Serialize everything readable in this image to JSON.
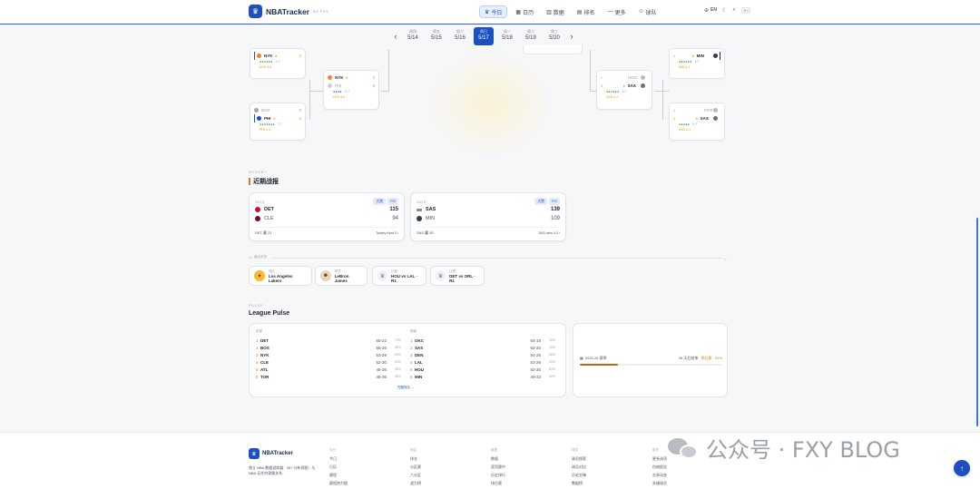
{
  "header": {
    "brand": "NBATracker",
    "brand_by": "BY FXY",
    "nav": [
      {
        "label": "今日",
        "icon": "trophy-icon",
        "active": true
      },
      {
        "label": "日历",
        "icon": "calendar-icon"
      },
      {
        "label": "数据",
        "icon": "bar-chart-icon"
      },
      {
        "label": "排名",
        "icon": "ranking-icon"
      },
      {
        "label": "更多",
        "icon": "more-icon"
      },
      {
        "label": "球队",
        "icon": "team-icon"
      }
    ],
    "lang": "EN",
    "search_hint": "⌘K"
  },
  "dates": [
    {
      "wd": "周四",
      "d": "5/14"
    },
    {
      "wd": "周五",
      "d": "5/15"
    },
    {
      "wd": "周六",
      "d": "5/16"
    },
    {
      "wd": "周日",
      "d": "5/17",
      "active": true
    },
    {
      "wd": "周一",
      "d": "5/18"
    },
    {
      "wd": "周二",
      "d": "5/19"
    },
    {
      "wd": "周三",
      "d": "5/20"
    }
  ],
  "bracket": {
    "m1": {
      "top": {
        "abbr": "NYK",
        "score": "4"
      },
      "games": "●●●●●●",
      "rest": "4/7",
      "status": "NYK 4-2"
    },
    "m2": {
      "top": {
        "seed": "3",
        "abbr": "BOS",
        "score": "3"
      },
      "bottom": {
        "abbr": "PHI",
        "score": "4"
      },
      "games": "●●●●●●●",
      "rest": "7/7",
      "status": "PHI 4-3"
    },
    "m3": {
      "top": {
        "abbr": "NYK",
        "score": "4"
      },
      "bottom": {
        "abbr": "PHI",
        "score": "0"
      },
      "games": "●●●●",
      "rest": "4/7",
      "status": "NYK 4-0"
    },
    "m4": {
      "top": {
        "seed": "4",
        "abbr": "MIN",
        "score": "4"
      },
      "games": "●●●●●●",
      "rest": "6/7",
      "status": "MIN 4-2"
    },
    "m5": {
      "top": {
        "seed": "2",
        "abbr": "HOU",
        "score": ""
      },
      "bottom": {
        "seed": "4",
        "abbr": "SAS",
        "score": "4"
      },
      "games": "●●●●●●",
      "rest": "6/7",
      "status": "SAS 4-2"
    },
    "m6": {
      "top": {
        "seed": "1",
        "abbr": "POR",
        "score": ""
      },
      "bottom": {
        "seed": "4",
        "abbr": "SAS",
        "score": "4"
      },
      "games": "●●●●●",
      "rest": "5/7",
      "status": "SAS 4-1"
    }
  },
  "recent": {
    "kicker": "RECENT",
    "title": "近期战报",
    "games": [
      {
        "date": "05/16",
        "tags": [
          "大胜",
          "PO"
        ],
        "a": "DET",
        "as": "115",
        "b": "CLE",
        "bs": "94",
        "foot": "DET 赢 21",
        "link": "Tankey Hard 3 ›"
      },
      {
        "date": "05/15",
        "tags": [
          "大胜",
          "PO"
        ],
        "a": "SAS",
        "as": "139",
        "b": "MIN",
        "bs": "109",
        "foot": "SAS 赢 30",
        "link": "SAS wins 4-2 ›"
      }
    ]
  },
  "recent_views": {
    "title": "最近浏览",
    "items": [
      {
        "type": "球队",
        "name": "Los Angeles Lakers"
      },
      {
        "type": "球员",
        "name": "LeBron James"
      },
      {
        "type": "比赛",
        "name": "HOU vs LAL · R1"
      },
      {
        "type": "比赛",
        "name": "DET vs ORL · R1"
      }
    ]
  },
  "pulse": {
    "kicker": "PULSE",
    "title": "League Pulse",
    "east_label": "东部",
    "west_label": "西部",
    "east": [
      {
        "rk": "1",
        "t": "DET",
        "rec": "60-22",
        "pct": "73%"
      },
      {
        "rk": "2",
        "t": "BOS",
        "rec": "56-26",
        "pct": "68%"
      },
      {
        "rk": "3",
        "t": "NYK",
        "rec": "53-29",
        "pct": "65%"
      },
      {
        "rk": "4",
        "t": "CLE",
        "rec": "52-30",
        "pct": "63%"
      },
      {
        "rk": "5",
        "t": "ATL",
        "rec": "46-36",
        "pct": "56%"
      },
      {
        "rk": "6",
        "t": "TOR",
        "rec": "46-36",
        "pct": "56%"
      }
    ],
    "west": [
      {
        "rk": "1",
        "t": "OKC",
        "rec": "64-18",
        "pct": "78%"
      },
      {
        "rk": "2",
        "t": "SAS",
        "rec": "62-20",
        "pct": "76%"
      },
      {
        "rk": "3",
        "t": "DEN",
        "rec": "54-28",
        "pct": "66%"
      },
      {
        "rk": "4",
        "t": "LAL",
        "rec": "53-29",
        "pct": "65%"
      },
      {
        "rk": "5",
        "t": "HOU",
        "rec": "52-30",
        "pct": "63%"
      },
      {
        "rk": "6",
        "t": "MIN",
        "rec": "49-33",
        "pct": "60%"
      }
    ],
    "see_all": "完整排名 →",
    "season_label": "2025-26 赛季",
    "season_right": "26 天后结束",
    "season_hl": "季后赛 · 51%",
    "season_progress": 0.51
  },
  "footer": {
    "brand": "NBATracker",
    "desc": "独立 NBA 数据追踪器 · 35+ 分析视图 · 与 NBA 无任何隶属关系",
    "cols": [
      {
        "h": "今日",
        "links": [
          "今日",
          "日历",
          "赛程",
          "赛程热力图"
        ]
      },
      {
        "h": "排名",
        "links": [
          "排名",
          "分区赛",
          "六分区",
          "战力榜"
        ]
      },
      {
        "h": "数据",
        "links": [
          "数据",
          "奖项赛中",
          "历史排行",
          "排位赛"
        ]
      },
      {
        "h": "球员",
        "links": [
          "球员搜索",
          "球员对比",
          "历史交锋",
          "数据榜"
        ]
      },
      {
        "h": "更多",
        "links": [
          "更多选项",
          "伤病报告",
          "交易动态",
          "关键球员"
        ]
      }
    ]
  },
  "watermark": "公众号 · FXY BLOG"
}
